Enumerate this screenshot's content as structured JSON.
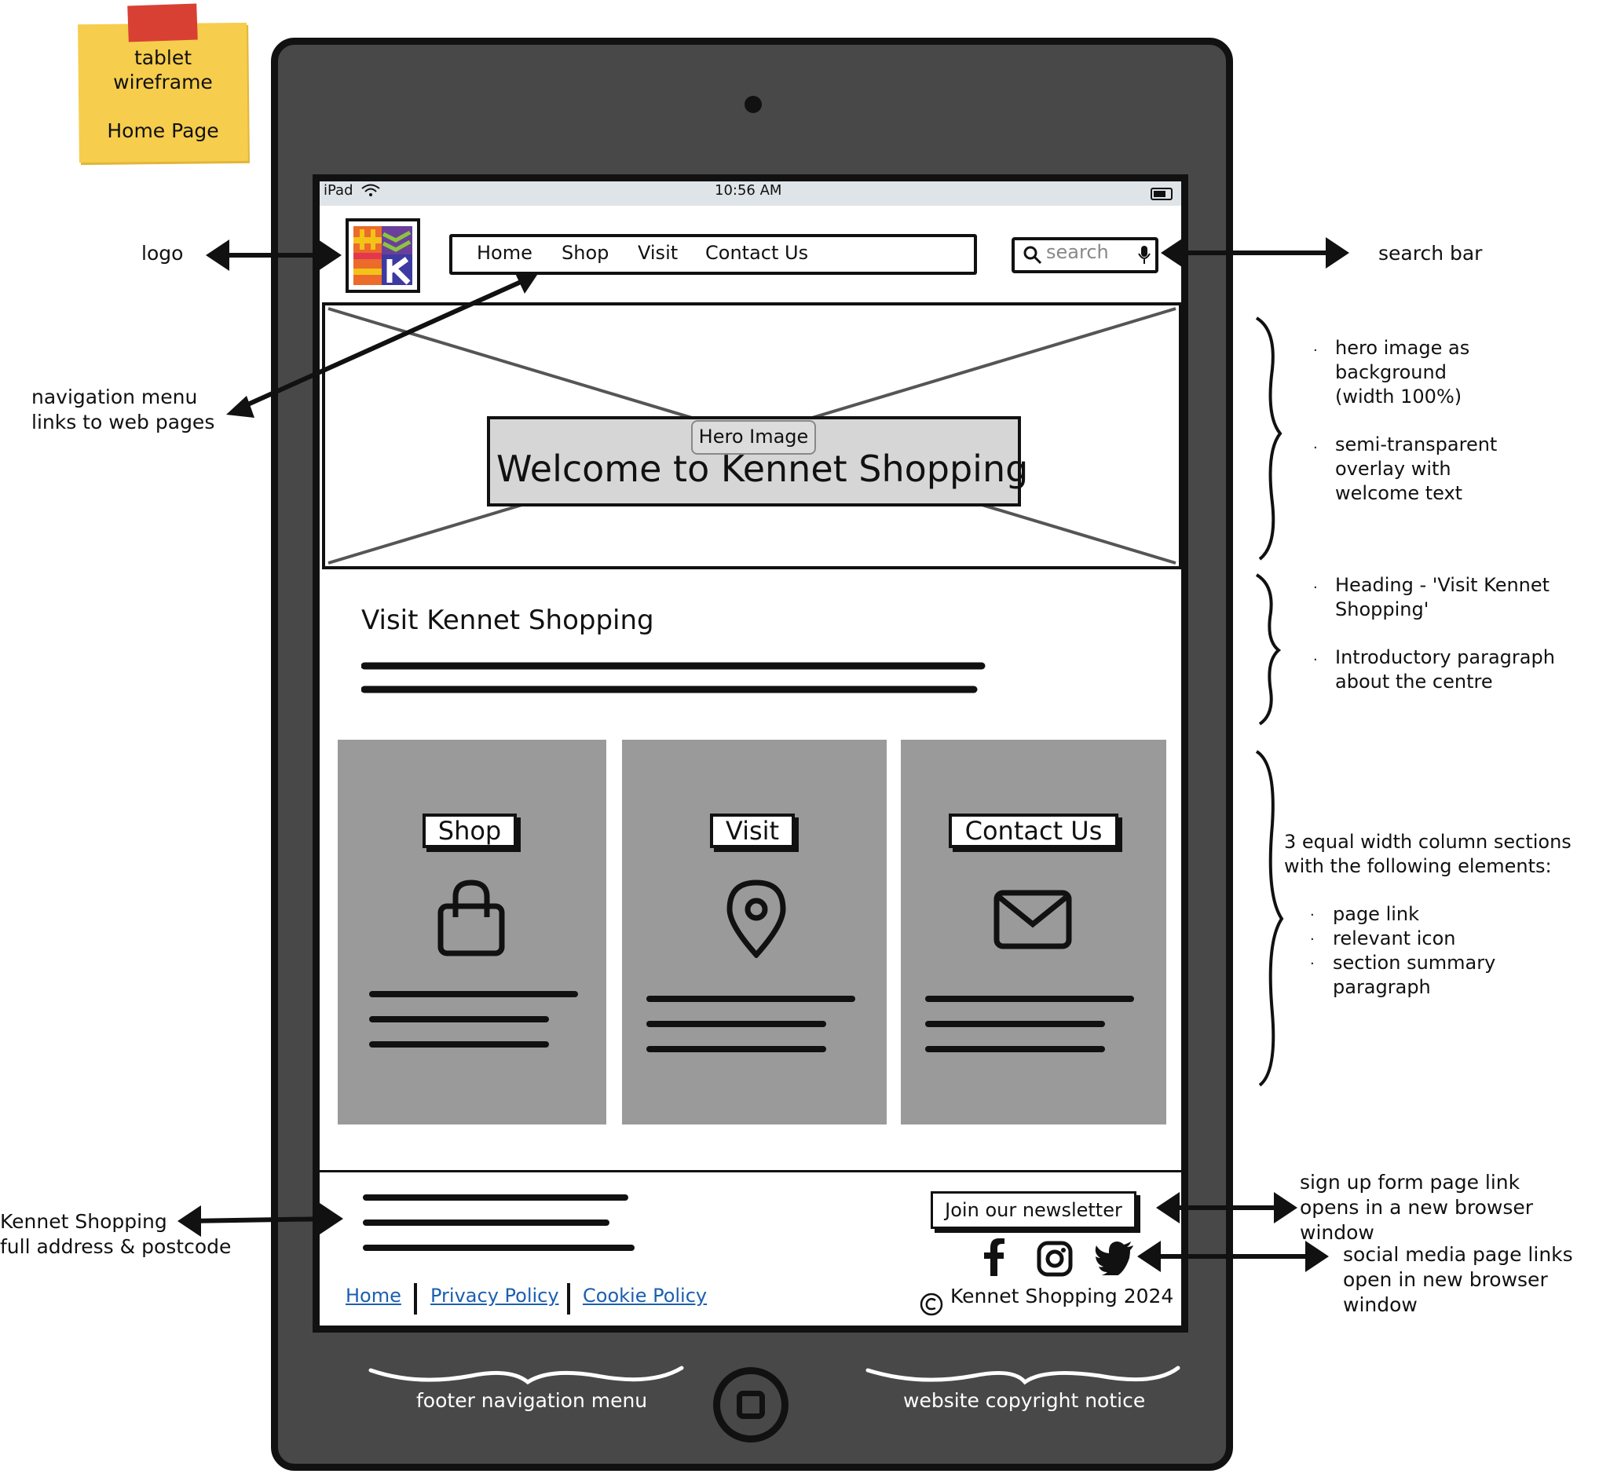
{
  "sticky_note": {
    "line1": "tablet",
    "line2": "wireframe",
    "line3": "Home Page"
  },
  "status_bar": {
    "device": "iPad",
    "time": "10:56 AM"
  },
  "nav": {
    "items": [
      "Home",
      "Shop",
      "Visit",
      "Contact Us"
    ]
  },
  "search": {
    "placeholder": "search"
  },
  "hero": {
    "label": "Hero Image",
    "title": "Welcome to Kennet Shopping"
  },
  "intro": {
    "heading": "Visit Kennet Shopping"
  },
  "columns": [
    {
      "label": "Shop",
      "icon": "shopping-bag-icon"
    },
    {
      "label": "Visit",
      "icon": "map-pin-icon"
    },
    {
      "label": "Contact Us",
      "icon": "mail-icon"
    }
  ],
  "footer": {
    "newsletter": "Join our newsletter",
    "links": [
      "Home",
      "Privacy Policy",
      "Cookie Policy"
    ],
    "copyright": "Kennet Shopping 2024",
    "social_icons": [
      "facebook-icon",
      "instagram-icon",
      "twitter-icon"
    ]
  },
  "annotations": {
    "logo": "logo",
    "search_bar": "search bar",
    "nav_menu_1": "navigation menu",
    "nav_menu_2": "links to web pages",
    "hero_1": "hero image as",
    "hero_2": "background",
    "hero_3": "(width 100%)",
    "hero_4": "semi-transparent",
    "hero_5": "overlay with",
    "hero_6": "welcome text",
    "heading_1": "Heading - 'Visit Kennet",
    "heading_2": "Shopping'",
    "heading_3": "Introductory paragraph",
    "heading_4": "about the centre",
    "cols_1": "3 equal width column sections",
    "cols_2": "with the following elements:",
    "cols_3": "page link",
    "cols_4": "relevant icon",
    "cols_5": "section summary",
    "cols_6": "paragraph",
    "address_1": "Kennet Shopping",
    "address_2": "full address & postcode",
    "signup_1": "sign up form page link",
    "signup_2": "opens in a new browser window",
    "social_1": "social media page links",
    "social_2": "open in new browser window",
    "footer_nav": "footer navigation menu",
    "copyright_note": "website copyright notice"
  },
  "colors": {
    "device": "#484848",
    "column": "#9a9a9a",
    "sticky": "#f6cd4c",
    "link": "#1b5fb0"
  }
}
